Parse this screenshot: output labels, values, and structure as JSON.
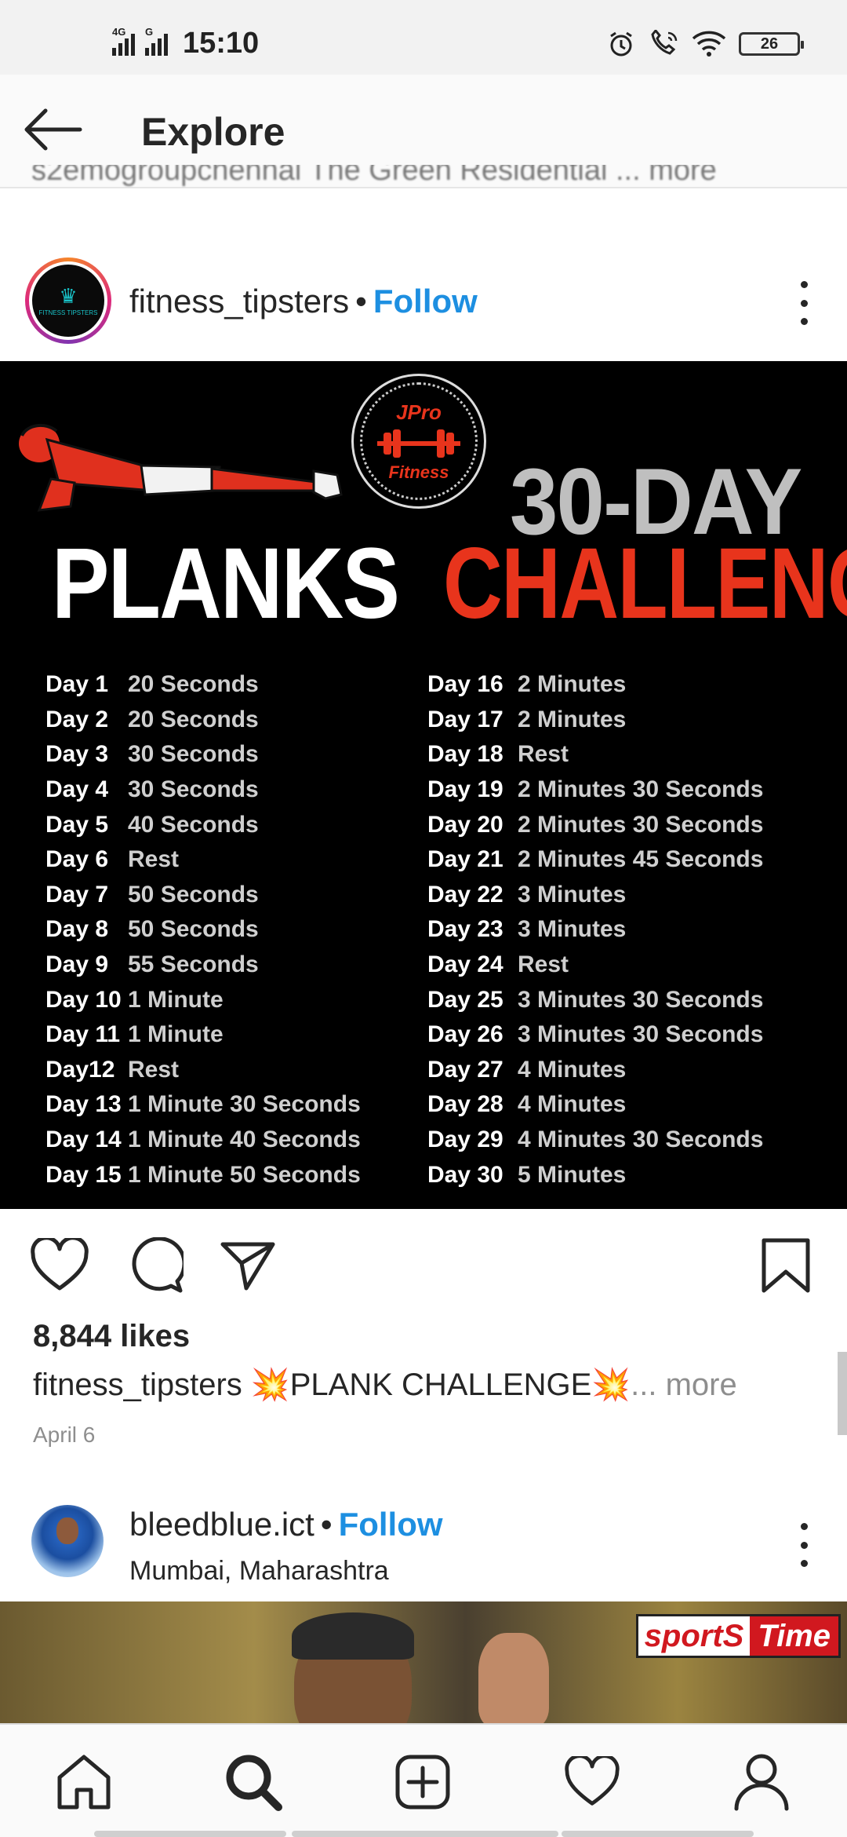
{
  "status_bar": {
    "signal1_tag": "4G",
    "signal2_tag": "G",
    "time": "15:10",
    "battery": "26"
  },
  "header": {
    "title": "Explore"
  },
  "previous_caption_fragment": "s2emogroupchennai The Green Residential ... more",
  "post1": {
    "username": "fitness_tipsters",
    "separator": "•",
    "follow": "Follow",
    "avatar_text": "FITNESS TIPSTERS",
    "image": {
      "logo_top": "JPro",
      "logo_bottom": "Fitness",
      "headline_days": "30-DAY",
      "headline_planks": "PLANKS",
      "headline_challenge": "CHALLENGE",
      "schedule_left": [
        {
          "day": "Day 1",
          "value": "20 Seconds"
        },
        {
          "day": "Day 2",
          "value": "20 Seconds"
        },
        {
          "day": "Day 3",
          "value": "30 Seconds"
        },
        {
          "day": "Day 4",
          "value": "30 Seconds"
        },
        {
          "day": "Day 5",
          "value": "40 Seconds"
        },
        {
          "day": "Day 6",
          "value": "Rest"
        },
        {
          "day": "Day 7",
          "value": "50 Seconds"
        },
        {
          "day": "Day 8",
          "value": "50 Seconds"
        },
        {
          "day": "Day 9",
          "value": "55 Seconds"
        },
        {
          "day": "Day 10",
          "value": "1 Minute"
        },
        {
          "day": "Day 11",
          "value": "1 Minute"
        },
        {
          "day": "Day12",
          "value": "Rest"
        },
        {
          "day": "Day 13",
          "value": "1 Minute 30 Seconds"
        },
        {
          "day": "Day 14",
          "value": "1 Minute 40 Seconds"
        },
        {
          "day": "Day 15",
          "value": "1 Minute 50 Seconds"
        }
      ],
      "schedule_right": [
        {
          "day": "Day 16",
          "value": "2 Minutes"
        },
        {
          "day": "Day 17",
          "value": "2 Minutes"
        },
        {
          "day": "Day 18",
          "value": "Rest"
        },
        {
          "day": "Day 19",
          "value": "2 Minutes 30 Seconds"
        },
        {
          "day": "Day 20",
          "value": "2 Minutes 30 Seconds"
        },
        {
          "day": "Day 21",
          "value": "2 Minutes 45 Seconds"
        },
        {
          "day": "Day 22",
          "value": "3 Minutes"
        },
        {
          "day": "Day 23",
          "value": "3 Minutes"
        },
        {
          "day": "Day 24",
          "value": "Rest"
        },
        {
          "day": "Day 25",
          "value": "3 Minutes 30 Seconds"
        },
        {
          "day": "Day 26",
          "value": "3 Minutes 30 Seconds"
        },
        {
          "day": "Day 27",
          "value": "4 Minutes"
        },
        {
          "day": "Day 28",
          "value": "4 Minutes"
        },
        {
          "day": "Day 29",
          "value": "4 Minutes 30 Seconds"
        },
        {
          "day": "Day 30",
          "value": "5 Minutes"
        }
      ]
    },
    "likes": "8,844 likes",
    "caption_user": "fitness_tipsters",
    "caption_text": "💥PLANK CHALLENGE💥",
    "caption_more": "... more",
    "date": "April 6"
  },
  "post2": {
    "username": "bleedblue.ict",
    "separator": "•",
    "follow": "Follow",
    "location": "Mumbai, Maharashtra",
    "badge_part1": "sportS",
    "badge_part2": "Time"
  },
  "icons": {
    "back": "back-arrow-icon",
    "like": "heart-icon",
    "comment": "comment-icon",
    "share": "send-icon",
    "save": "bookmark-icon",
    "nav": [
      "home-icon",
      "search-icon",
      "add-post-icon",
      "activity-heart-icon",
      "profile-icon"
    ]
  },
  "colors": {
    "follow": "#1d8fe1",
    "challenge_red": "#e8341c",
    "text": "#262626",
    "muted": "#8e8e8e"
  }
}
